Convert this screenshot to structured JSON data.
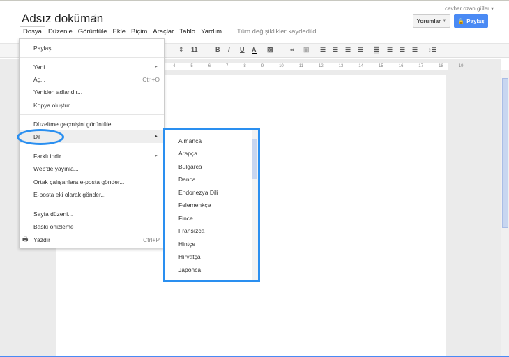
{
  "header": {
    "title": "Adsız doküman",
    "user": "cevher ozan güler ▾",
    "comments_label": "Yorumlar",
    "share_label": "Paylaş"
  },
  "menubar": {
    "items": [
      "Dosya",
      "Düzenle",
      "Görüntüle",
      "Ekle",
      "Biçim",
      "Araçlar",
      "Tablo",
      "Yardım"
    ],
    "status": "Tüm değişiklikler kaydedildi"
  },
  "toolbar": {
    "font_size": "11",
    "bold": "B",
    "italic": "I",
    "underline": "U",
    "text_color": "A"
  },
  "ruler": [
    "4",
    "5",
    "6",
    "7",
    "8",
    "9",
    "10",
    "11",
    "12",
    "13",
    "14",
    "15",
    "16",
    "17",
    "18",
    "19"
  ],
  "file_menu": {
    "items": [
      {
        "label": "Paylaş..."
      },
      {
        "label": "Yeni",
        "submenu": true
      },
      {
        "label": "Aç...",
        "shortcut": "Ctrl+O"
      },
      {
        "label": "Yeniden adlandır..."
      },
      {
        "label": "Kopya oluştur..."
      },
      {
        "label": "Düzeltme geçmişini görüntüle"
      },
      {
        "label": "Dil",
        "submenu": true,
        "highlighted": true
      },
      {
        "label": "Farklı indir",
        "submenu": true
      },
      {
        "label": "Web'de yayınla..."
      },
      {
        "label": "Ortak çalışanlara e-posta gönder..."
      },
      {
        "label": "E-posta eki olarak gönder..."
      },
      {
        "label": "Sayfa düzeni..."
      },
      {
        "label": "Baskı önizleme"
      },
      {
        "label": "Yazdır",
        "shortcut": "Ctrl+P",
        "icon": "printer-icon"
      }
    ]
  },
  "language_menu": {
    "items": [
      "Almanca",
      "Arapça",
      "Bulgarca",
      "Danca",
      "Endonezya Dili",
      "Felemenkçe",
      "Fince",
      "Fransızca",
      "Hintçe",
      "Hırvatça",
      "Japonca"
    ]
  },
  "colors": {
    "accent": "#4a8af4",
    "annotation": "#2a8ff0"
  }
}
